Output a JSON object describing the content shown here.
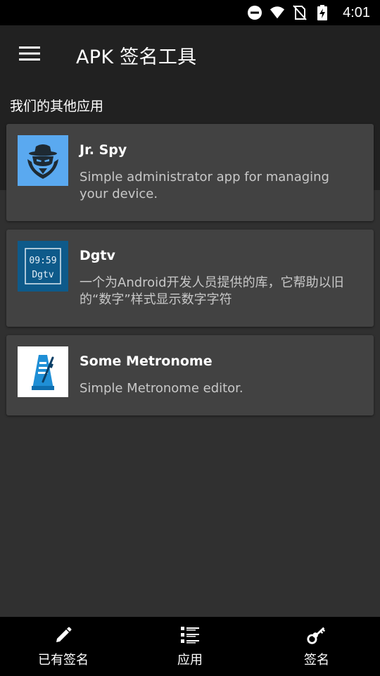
{
  "status_bar": {
    "time": "4:01",
    "icons": [
      "do-not-disturb-icon",
      "wifi-icon",
      "no-sim-icon",
      "battery-charging-icon"
    ]
  },
  "app_bar": {
    "title": "APK 签名工具",
    "menu_icon": "hamburger-menu-icon"
  },
  "section": {
    "header": "我们的其他应用"
  },
  "apps": [
    {
      "title": "Jr. Spy",
      "description": "Simple administrator app for managing your device.",
      "icon": "spy-agent-icon",
      "icon_bg": "#5aa9f0"
    },
    {
      "title": "Dgtv",
      "description": "一个为Android开发人员提供的库，它帮助以旧的“数字”样式显示数字字符",
      "icon": "digital-clock-icon",
      "icon_bg": "#0e5a8a",
      "icon_text_time": "09:59",
      "icon_text_name": "Dgtv"
    },
    {
      "title": "Some Metronome",
      "description": "Simple Metronome editor.",
      "icon": "metronome-icon",
      "icon_bg": "#ffffff"
    }
  ],
  "bottom_nav": {
    "items": [
      {
        "label": "已有签名",
        "icon": "pencil-icon"
      },
      {
        "label": "应用",
        "icon": "list-icon"
      },
      {
        "label": "签名",
        "icon": "keys-icon"
      }
    ]
  },
  "colors": {
    "app_bar": "#212121",
    "background": "#303030",
    "card": "#424242",
    "bottom_nav": "#000000"
  }
}
